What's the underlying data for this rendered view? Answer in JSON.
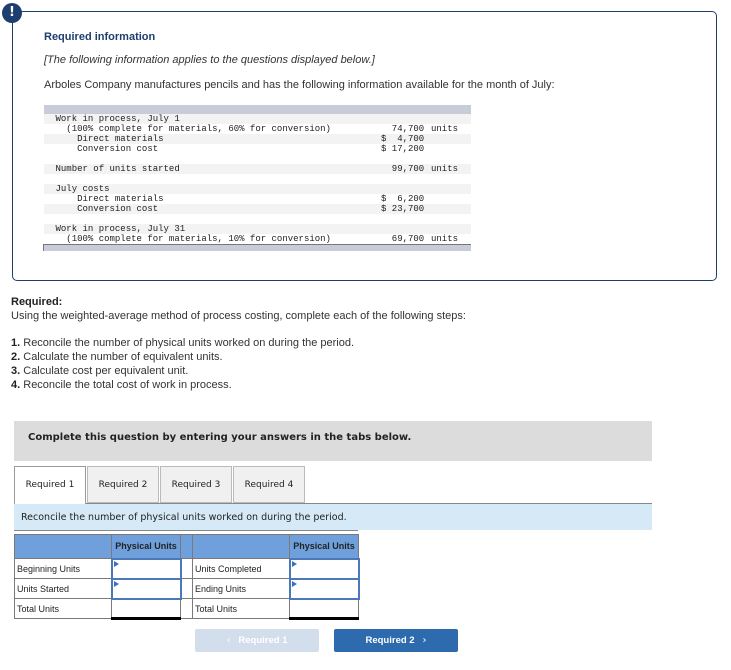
{
  "info": {
    "alert_icon": "!",
    "title": "Required information",
    "note": "[The following information applies to the questions displayed below.]",
    "description": "Arboles Company manufactures pencils and has the following information available for the month of July:",
    "rows": [
      {
        "label": "Work in process, July 1",
        "indent": 0,
        "amount": "",
        "unit": ""
      },
      {
        "label": "  (100% complete for materials, 60% for conversion)",
        "indent": 0,
        "amount": "  74,700",
        "unit": "units"
      },
      {
        "label": "    Direct materials",
        "indent": 0,
        "amount": "$  4,700",
        "unit": ""
      },
      {
        "label": "    Conversion cost",
        "indent": 0,
        "amount": "$ 17,200",
        "unit": ""
      },
      {
        "label": "Number of units started",
        "indent": 0,
        "amount": "  99,700",
        "unit": "units"
      },
      {
        "label": "July costs",
        "indent": 0,
        "amount": "",
        "unit": ""
      },
      {
        "label": "    Direct materials",
        "indent": 0,
        "amount": "$  6,200",
        "unit": ""
      },
      {
        "label": "    Conversion cost",
        "indent": 0,
        "amount": "$ 23,700",
        "unit": ""
      },
      {
        "label": "Work in process, July 31",
        "indent": 0,
        "amount": "",
        "unit": ""
      },
      {
        "label": "  (100% complete for materials, 10% for conversion)",
        "indent": 0,
        "amount": "  69,700",
        "unit": "units"
      }
    ]
  },
  "required": {
    "title": "Required:",
    "intro": "Using the weighted-average method of process costing, complete each of the following steps:",
    "steps": [
      {
        "num": "1.",
        "text": " Reconcile the number of physical units worked on during the period."
      },
      {
        "num": "2.",
        "text": " Calculate the number of equivalent units."
      },
      {
        "num": "3.",
        "text": " Calculate cost per equivalent unit."
      },
      {
        "num": "4.",
        "text": " Reconcile the total cost of work in process."
      }
    ]
  },
  "complete_bar": "Complete this question by entering your answers in the tabs below.",
  "tabs": [
    {
      "label": "Required 1",
      "active": true
    },
    {
      "label": "Required 2",
      "active": false
    },
    {
      "label": "Required 3",
      "active": false
    },
    {
      "label": "Required 4",
      "active": false
    }
  ],
  "instruction": "Reconcile the number of physical units worked on during the period.",
  "units_table": {
    "header_left": "Physical Units",
    "header_right": "Physical Units",
    "left_rows": [
      {
        "label": "Beginning Units",
        "value": ""
      },
      {
        "label": "Units Started",
        "value": ""
      },
      {
        "label": "Total Units",
        "value": ""
      }
    ],
    "right_rows": [
      {
        "label": "Units Completed",
        "value": ""
      },
      {
        "label": "Ending Units",
        "value": ""
      },
      {
        "label": "Total Units",
        "value": ""
      }
    ]
  },
  "nav": {
    "prev_label": "Required 1",
    "next_label": "Required 2",
    "prev_icon": "‹",
    "next_icon": "›"
  }
}
